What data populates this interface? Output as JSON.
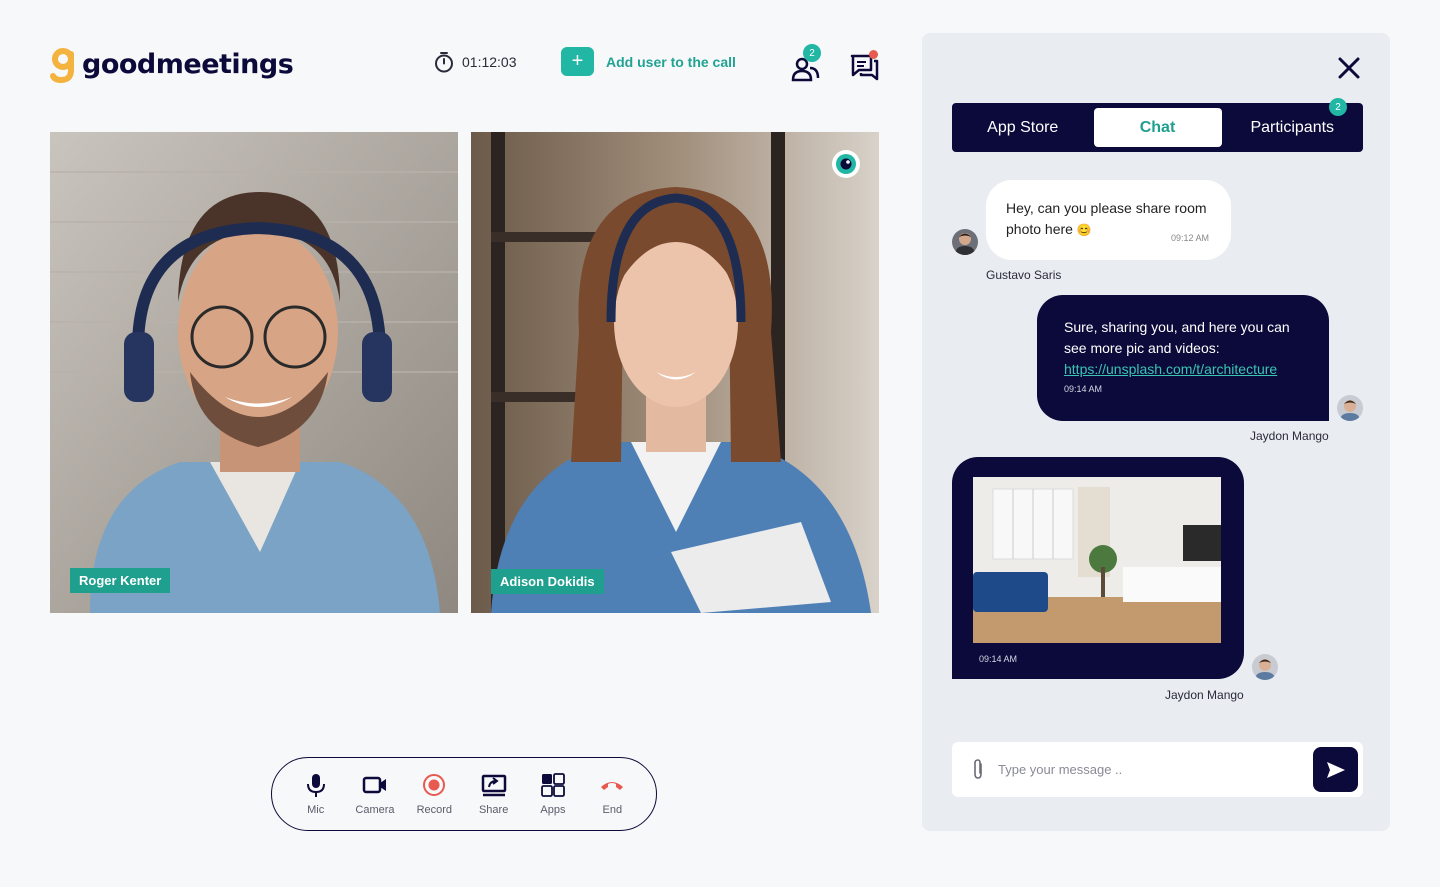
{
  "app": {
    "name": "goodmeetings"
  },
  "header": {
    "timer": "01:12:03",
    "add_user_label": "Add  user to the call",
    "participants_badge": "2"
  },
  "videos": [
    {
      "name": "Roger Kenter",
      "speaking": false
    },
    {
      "name": "Adison Dokidis",
      "speaking": true
    }
  ],
  "controls": [
    {
      "label": "Mic",
      "icon": "mic-icon"
    },
    {
      "label": "Camera",
      "icon": "camera-icon"
    },
    {
      "label": "Record",
      "icon": "record-icon"
    },
    {
      "label": "Share",
      "icon": "share-screen-icon"
    },
    {
      "label": "Apps",
      "icon": "apps-icon"
    },
    {
      "label": "End",
      "icon": "end-call-icon"
    }
  ],
  "panel": {
    "tabs": [
      {
        "label": "App Store"
      },
      {
        "label": "Chat",
        "active": true
      },
      {
        "label": "Participants",
        "badge": "2"
      }
    ],
    "messages": [
      {
        "text": "Hey, can you please share room photo here",
        "emoji": "😊",
        "time": "09:12 AM",
        "sender": "Gustavo Saris"
      },
      {
        "text": "Sure, sharing you, and here you can see more pic and videos:",
        "link": "https://unsplash.com/t/architecture",
        "time": "09:14 AM",
        "sender": "Jaydon Mango"
      },
      {
        "time": "09:14 AM",
        "sender": "Jaydon Mango"
      }
    ],
    "composer": {
      "placeholder": "Type your message .."
    }
  },
  "colors": {
    "navy": "#0b0a3a",
    "teal": "#21b7a4",
    "red": "#e85a4f",
    "orange": "#f4b23e"
  }
}
